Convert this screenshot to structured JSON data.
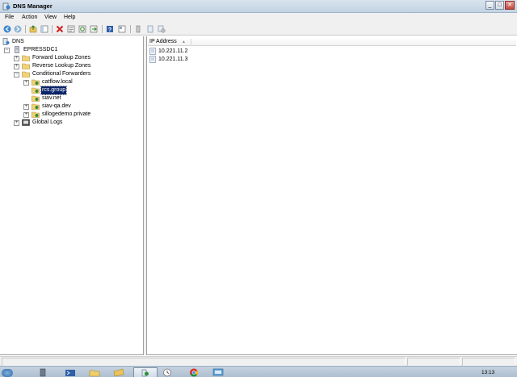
{
  "window": {
    "title": "DNS Manager",
    "controls": {
      "minimize": "_",
      "maximize": "□",
      "close": "✕"
    }
  },
  "menu": [
    {
      "label": "File"
    },
    {
      "label": "Action"
    },
    {
      "label": "View"
    },
    {
      "label": "Help"
    }
  ],
  "toolbar": {
    "buttons": [
      "back-icon",
      "forward-icon",
      "up-folder-icon",
      "show-hide-tree-icon",
      "delete-icon",
      "properties-icon",
      "refresh-icon",
      "export-list-icon",
      "help-icon",
      "console-tree-icon",
      "server-icon",
      "record-icon",
      "records-icon"
    ]
  },
  "tree": {
    "root": {
      "label": "DNS"
    },
    "server": {
      "label": "EPRESSDC1"
    },
    "forward_zones": {
      "label": "Forward Lookup Zones"
    },
    "reverse_zones": {
      "label": "Reverse Lookup Zones"
    },
    "conditional_forwarders": {
      "label": "Conditional Forwarders",
      "items": [
        {
          "label": "catflow.local",
          "selected": false,
          "has_children": true
        },
        {
          "label": "rcs.group",
          "selected": true,
          "has_children": false
        },
        {
          "label": "siav.net",
          "selected": false,
          "has_children": false
        },
        {
          "label": "siav-qa.dev",
          "selected": false,
          "has_children": true
        },
        {
          "label": "sillogedemo.private",
          "selected": false,
          "has_children": true
        }
      ]
    },
    "global_logs": {
      "label": "Global Logs"
    }
  },
  "list": {
    "column_header": "IP Address",
    "rows": [
      {
        "ip": "10.221.11.2"
      },
      {
        "ip": "10.221.11.3"
      }
    ]
  },
  "taskbar": {
    "clock": "13:13",
    "apps": [
      "server-manager-icon",
      "powershell-icon",
      "explorer-icon",
      "folder-icon",
      "dns-manager-icon",
      "clock-icon",
      "chrome-icon",
      "remote-desktop-icon"
    ]
  }
}
